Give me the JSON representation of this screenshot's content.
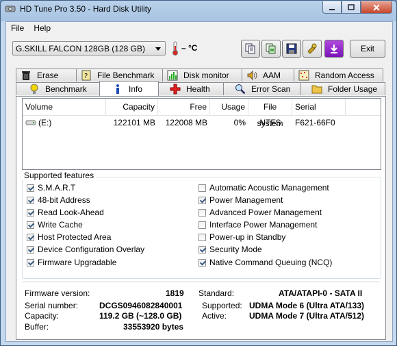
{
  "window": {
    "title": "HD Tune Pro 3.50 - Hard Disk Utility"
  },
  "menu": {
    "file": "File",
    "help": "Help"
  },
  "toolbar": {
    "drive": "G.SKILL FALCON 128GB (128 GB)",
    "temperature": "– °C",
    "exit_label": "Exit",
    "icons": [
      "copy-info-icon",
      "copy-screen-icon",
      "save-icon",
      "options-icon",
      "download-icon"
    ]
  },
  "tabs": {
    "top": [
      {
        "label": "Erase",
        "icon": "trash-icon"
      },
      {
        "label": "File Benchmark",
        "icon": "file-benchmark-icon"
      },
      {
        "label": "Disk monitor",
        "icon": "disk-monitor-icon"
      },
      {
        "label": "AAM",
        "icon": "speaker-icon"
      },
      {
        "label": "Random Access",
        "icon": "random-access-icon"
      }
    ],
    "bottom": [
      {
        "label": "Benchmark",
        "icon": "lightbulb-icon"
      },
      {
        "label": "Info",
        "icon": "info-icon"
      },
      {
        "label": "Health",
        "icon": "health-cross-icon"
      },
      {
        "label": "Error Scan",
        "icon": "magnifier-icon"
      },
      {
        "label": "Folder Usage",
        "icon": "folder-icon"
      }
    ],
    "active": "Info"
  },
  "volumes": {
    "columns": [
      "Volume",
      "Capacity",
      "Free",
      "Usage",
      "File system",
      "Serial"
    ],
    "rows": [
      {
        "volume": "(E:)",
        "capacity": "122101 MB",
        "free": "122008 MB",
        "usage": "0%",
        "fs": "NTFS",
        "serial": "F621-66F0"
      }
    ]
  },
  "features": {
    "label": "Supported features",
    "left": [
      {
        "name": "S.M.A.R.T",
        "checked": true
      },
      {
        "name": "48-bit Address",
        "checked": true
      },
      {
        "name": "Read Look-Ahead",
        "checked": true
      },
      {
        "name": "Write Cache",
        "checked": true
      },
      {
        "name": "Host Protected Area",
        "checked": true
      },
      {
        "name": "Device Configuration Overlay",
        "checked": true
      },
      {
        "name": "Firmware Upgradable",
        "checked": true
      }
    ],
    "right": [
      {
        "name": "Automatic Acoustic Management",
        "checked": false
      },
      {
        "name": "Power Management",
        "checked": true
      },
      {
        "name": "Advanced Power Management",
        "checked": false
      },
      {
        "name": "Interface Power Management",
        "checked": false
      },
      {
        "name": "Power-up in Standby",
        "checked": false
      },
      {
        "name": "Security Mode",
        "checked": true
      },
      {
        "name": "Native Command Queuing (NCQ)",
        "checked": true
      }
    ]
  },
  "details": {
    "firmware_label": "Firmware version:",
    "firmware": "1819",
    "serial_label": "Serial number:",
    "serial": "DCGS0946082840001",
    "capacity_label": "Capacity:",
    "capacity": "119.2 GB (~128.0 GB)",
    "buffer_label": "Buffer:",
    "buffer": "33553920 bytes",
    "standard_label": "Standard:",
    "standard": "ATA/ATAPI-0 - SATA II",
    "supported_label": "Supported:",
    "supported": "UDMA Mode 6 (Ultra ATA/133)",
    "active_label": "Active:",
    "active": "UDMA Mode 7 (Ultra ATA/512)"
  }
}
